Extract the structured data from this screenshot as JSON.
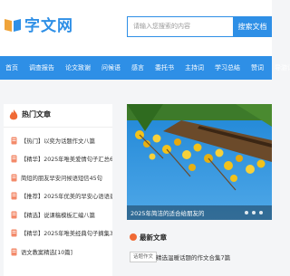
{
  "header": {
    "logo_text": "字文网",
    "search_placeholder": "请输入您搜索的内容",
    "search_button": "搜索文档"
  },
  "nav": {
    "items": [
      "首页",
      "调查报告",
      "论文致谢",
      "问候语",
      "感言",
      "委托书",
      "主持词",
      "学习总结",
      "赞词",
      "导游词"
    ]
  },
  "hot": {
    "title": "热门文章",
    "items": [
      "【热门】以奕为话题作文八篇",
      "【精华】2025年唯美爱情句子汇总60条",
      "简短的朋友早安问候语短信45句",
      "【推荐】2025年优美的早安心语语录摘",
      "【精选】说课稿模板汇编八篇",
      "【精华】2025年唯美经典句子摘集39句",
      "语文教案精选[10篇]"
    ]
  },
  "banner": {
    "caption": "2025年简洁的适合给朋友的"
  },
  "latest": {
    "title": "最新文章",
    "tag": "话题作文",
    "text": "精选温暖话题的作文合集7篇"
  },
  "colors": {
    "brand": "#2e8fe6",
    "accent": "#f06a35"
  }
}
